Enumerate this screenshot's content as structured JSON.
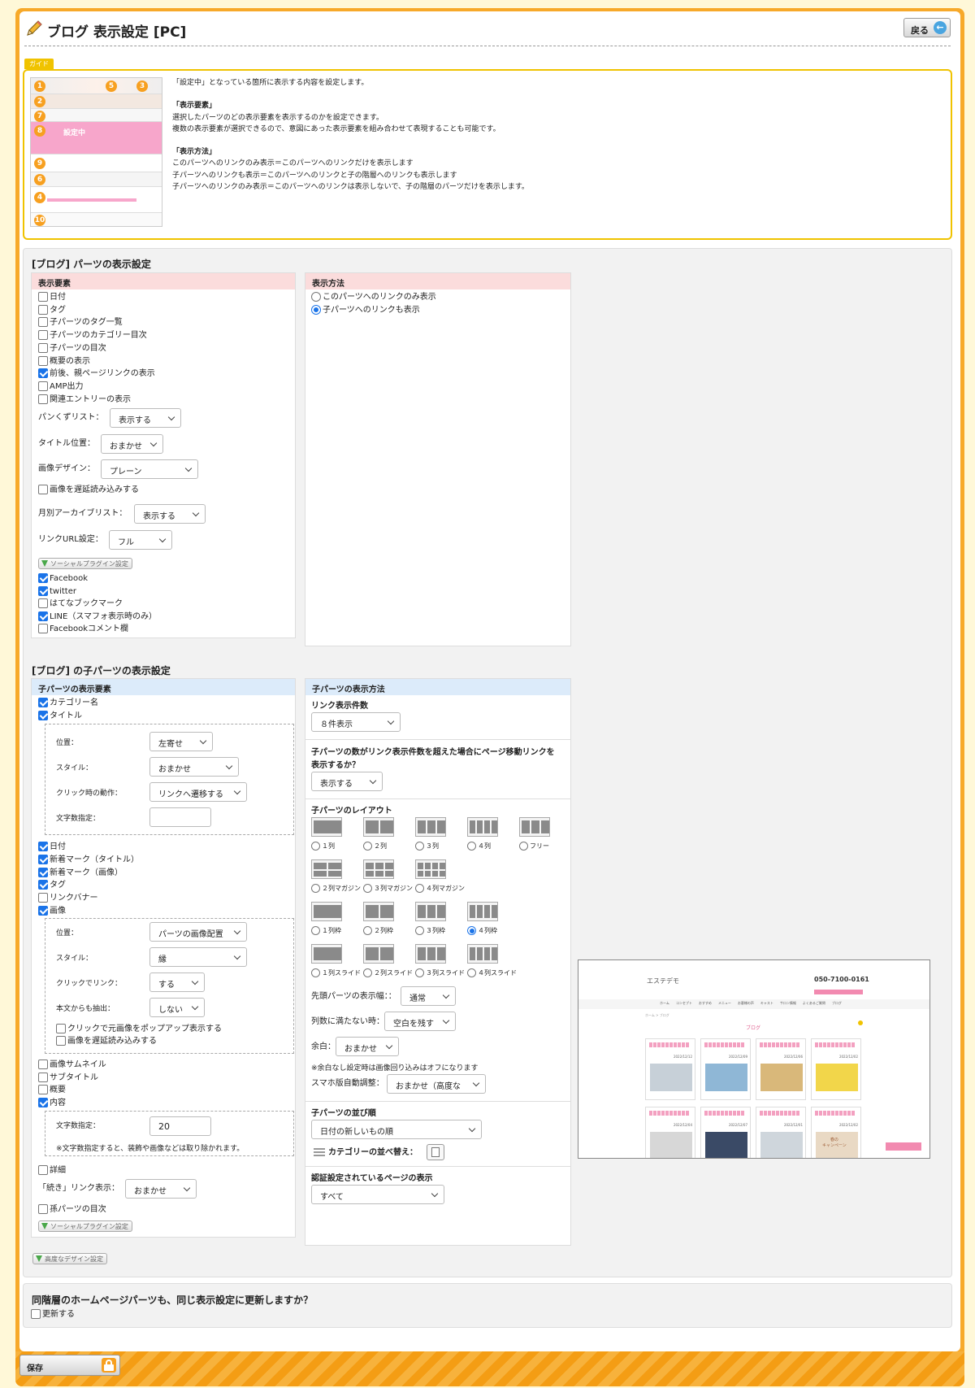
{
  "header": {
    "title": "ブログ 表示設定 [PC]",
    "back_label": "戻る"
  },
  "guide": {
    "tab": "ガイド",
    "thumb_label": "設定中",
    "thumb_numbers": [
      "1",
      "2",
      "7",
      "8",
      "9",
      "6",
      "4",
      "10",
      "5",
      "3"
    ],
    "lines": [
      "「設定中」となっている箇所に表示する内容を設定します。",
      "",
      "「表示要素」",
      "選択したパーツのどの表示要素を表示するのかを設定できます。",
      "複数の表示要素が選択できるので、意図にあった表示要素を組み合わせて表現することも可能です。",
      "",
      "「表示方法」",
      "このパーツへのリンクのみ表示＝このパーツへのリンクだけを表示します",
      "子パーツへのリンクも表示＝このパーツへのリンクと子の階層へのリンクも表示します",
      "子パーツへのリンクのみ表示＝このパーツへのリンクは表示しないで、子の階層のパーツだけを表示します。"
    ]
  },
  "parts": {
    "title": "[ブログ] パーツの表示設定",
    "elements_head": "表示要素",
    "method_head": "表示方法",
    "checks": [
      {
        "label": "日付",
        "checked": false
      },
      {
        "label": "タグ",
        "checked": false
      },
      {
        "label": "子パーツのタグ一覧",
        "checked": false
      },
      {
        "label": "子パーツのカテゴリー目次",
        "checked": false
      },
      {
        "label": "子パーツの目次",
        "checked": false
      },
      {
        "label": "概要の表示",
        "checked": false
      },
      {
        "label": "前後、親ページリンクの表示",
        "checked": true
      },
      {
        "label": "AMP出力",
        "checked": false
      },
      {
        "label": "関連エントリーの表示",
        "checked": false
      }
    ],
    "breadcrumb_label": "パンくずリスト：",
    "breadcrumb_value": "表示する",
    "title_pos_label": "タイトル位置：",
    "title_pos_value": "おまかせ",
    "image_design_label": "画像デザイン：",
    "image_design_value": "プレーン",
    "lazy_label": "画像を遅延読み込みする",
    "lazy_checked": false,
    "archive_label": "月別アーカイブリスト：",
    "archive_value": "表示する",
    "linkurl_label": "リンクURL設定：",
    "linkurl_value": "フル",
    "social_btn": "ソーシャルプラグイン設定",
    "social": [
      {
        "label": "Facebook",
        "checked": true
      },
      {
        "label": "twitter",
        "checked": true
      },
      {
        "label": "はてなブックマーク",
        "checked": false
      },
      {
        "label": "LINE（スマフォ表示時のみ）",
        "checked": true
      },
      {
        "label": "Facebookコメント欄",
        "checked": false
      }
    ],
    "methods": [
      {
        "label": "このパーツへのリンクのみ表示",
        "selected": false
      },
      {
        "label": "子パーツへのリンクも表示",
        "selected": true
      }
    ]
  },
  "child": {
    "title": "[ブログ] の子パーツの表示設定",
    "elements_head": "子パーツの表示要素",
    "method_head": "子パーツの表示方法",
    "checks_a": [
      {
        "label": "カテゴリー名",
        "checked": true
      },
      {
        "label": "タイトル",
        "checked": true
      }
    ],
    "title_opts": [
      {
        "label": "位置：",
        "value": "左寄せ"
      },
      {
        "label": "スタイル：",
        "value": "おまかせ"
      },
      {
        "label": "クリック時の動作：",
        "value": "リンクへ遷移する"
      },
      {
        "label": "文字数指定：",
        "value": ""
      }
    ],
    "checks_b": [
      {
        "label": "日付",
        "checked": true
      },
      {
        "label": "新着マーク（タイトル）",
        "checked": true
      },
      {
        "label": "新着マーク（画像）",
        "checked": true
      },
      {
        "label": "タグ",
        "checked": true
      },
      {
        "label": "リンクバナー",
        "checked": false
      },
      {
        "label": "画像",
        "checked": true
      }
    ],
    "image_opts": [
      {
        "label": "位置：",
        "value": "パーツの画像配置"
      },
      {
        "label": "スタイル：",
        "value": "縁"
      },
      {
        "label": "クリックでリンク：",
        "value": "する"
      },
      {
        "label": "本文からも抽出：",
        "value": "しない"
      }
    ],
    "image_checks": [
      {
        "label": "クリックで元画像をポップアップ表示する",
        "checked": false
      },
      {
        "label": "画像を遅延読み込みする",
        "checked": false
      }
    ],
    "checks_c": [
      {
        "label": "画像サムネイル",
        "checked": false
      },
      {
        "label": "サブタイトル",
        "checked": false
      },
      {
        "label": "概要",
        "checked": false
      },
      {
        "label": "内容",
        "checked": true
      }
    ],
    "content_len_label": "文字数指定：",
    "content_len_value": "20",
    "content_note": "※文字数指定すると、装飾や画像などは取り除かれます。",
    "detail_label": "詳細",
    "detail_checked": false,
    "more_label": "「続き」リンク表示：",
    "more_value": "おまかせ",
    "grand_label": "孫パーツの目次",
    "grand_checked": false,
    "social_btn": "ソーシャルプラグイン設定",
    "link_count_head": "リンク表示件数",
    "link_count_value": "８件表示",
    "paging_head_1": "子パーツの数がリンク表示件数を超えた場合にページ移動リンクを",
    "paging_head_2": "表示するか？",
    "paging_value": "表示する",
    "layout_head": "子パーツのレイアウト",
    "layouts": [
      {
        "label": "１列",
        "selected": false
      },
      {
        "label": "２列",
        "selected": false
      },
      {
        "label": "３列",
        "selected": false
      },
      {
        "label": "４列",
        "selected": false
      },
      {
        "label": "フリー",
        "selected": false
      },
      {
        "label": "２列マガジン",
        "selected": false
      },
      {
        "label": "３列マガジン",
        "selected": false
      },
      {
        "label": "４列マガジン",
        "selected": false
      },
      {
        "label": "１列枠",
        "selected": false
      },
      {
        "label": "２列枠",
        "selected": false
      },
      {
        "label": "３列枠",
        "selected": false
      },
      {
        "label": "４列枠",
        "selected": true
      },
      {
        "label": "１列スライド",
        "selected": false
      },
      {
        "label": "２列スライド",
        "selected": false
      },
      {
        "label": "３列スライド",
        "selected": false
      },
      {
        "label": "４列スライド",
        "selected": false
      }
    ],
    "lead_width_label": "先頭パーツの表示幅：：",
    "lead_width_value": "通常",
    "short_label": "列数に満たない時：",
    "short_value": "空白を残す",
    "margin_label": "余白：",
    "margin_value": "おまかせ",
    "margin_note": "※余白なし設定時は画像回り込みはオフになります",
    "sp_label": "スマホ版自動調整：",
    "sp_value": "おまかせ（高度な",
    "order_head": "子パーツの並び順",
    "order_value": "日付の新しいもの順",
    "cat_order_label": "カテゴリーの並べ替え：",
    "auth_head": "認証設定されているページの表示",
    "auth_value": "すべて",
    "advanced_btn": "高度なデザイン設定"
  },
  "preview": {
    "brand": "エステデモ",
    "phone": "050-7100-0161",
    "nav": [
      "ホーム",
      "コンセプト",
      "おすすめ",
      "メニュー",
      "お客様の声",
      "キャスト",
      "サロン情報",
      "よくあるご質問",
      "ブログ"
    ],
    "section": "ブログ",
    "crumb": "ホーム > ブログ",
    "campaign": "春の\nキャンペーン",
    "dates": [
      "2022/12/12",
      "2022/12/09",
      "2022/12/06",
      "2022/12/02",
      "2022/12/04",
      "2022/12/07",
      "2022/12/01",
      "2022/12/02"
    ]
  },
  "sync": {
    "question": "同階層のホームページパーツも、同じ表示設定に更新しますか？",
    "label": "更新する",
    "checked": false
  },
  "footer": {
    "save_label": "保存"
  },
  "colors": {
    "accent": "#f7a92a",
    "guide_border": "#f0c300",
    "pink_head": "#fbdcdc",
    "blue_head": "#dcebfa",
    "check": "#1a73e8"
  }
}
